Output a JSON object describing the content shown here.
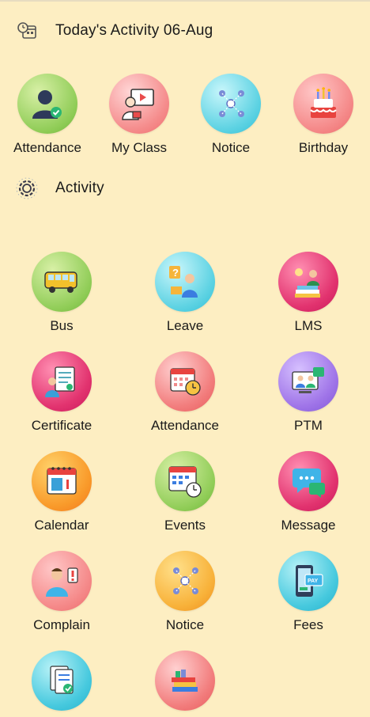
{
  "header_today": {
    "title": "Today's Activity 06-Aug",
    "icon": "calendar-clock-icon"
  },
  "today_items": [
    {
      "label": "Attendance",
      "icon": "attendance-user-check-icon"
    },
    {
      "label": "My Class",
      "icon": "teacher-screen-icon"
    },
    {
      "label": "Notice",
      "icon": "network-notice-icon"
    },
    {
      "label": "Birthday",
      "icon": "birthday-cake-icon"
    }
  ],
  "header_activity": {
    "title": "Activity",
    "icon": "gear-icon"
  },
  "activity_items": [
    {
      "label": "Bus",
      "icon": "school-bus-icon"
    },
    {
      "label": "Leave",
      "icon": "question-person-icon"
    },
    {
      "label": "LMS",
      "icon": "reading-books-icon"
    },
    {
      "label": "Certificate",
      "icon": "certificate-icon"
    },
    {
      "label": "Attendance",
      "icon": "calendar-clock-icon"
    },
    {
      "label": "PTM",
      "icon": "video-meeting-icon"
    },
    {
      "label": "Calendar",
      "icon": "calendar-icon"
    },
    {
      "label": "Events",
      "icon": "events-calendar-icon"
    },
    {
      "label": "Message",
      "icon": "chat-bubble-icon"
    },
    {
      "label": "Complain",
      "icon": "complain-person-icon"
    },
    {
      "label": "Notice",
      "icon": "network-notice-icon"
    },
    {
      "label": "Fees",
      "icon": "pay-phone-icon"
    },
    {
      "label": "",
      "icon": "document-check-icon"
    },
    {
      "label": "",
      "icon": "books-stack-icon"
    }
  ],
  "colors": {
    "background": "#fdeec2"
  }
}
